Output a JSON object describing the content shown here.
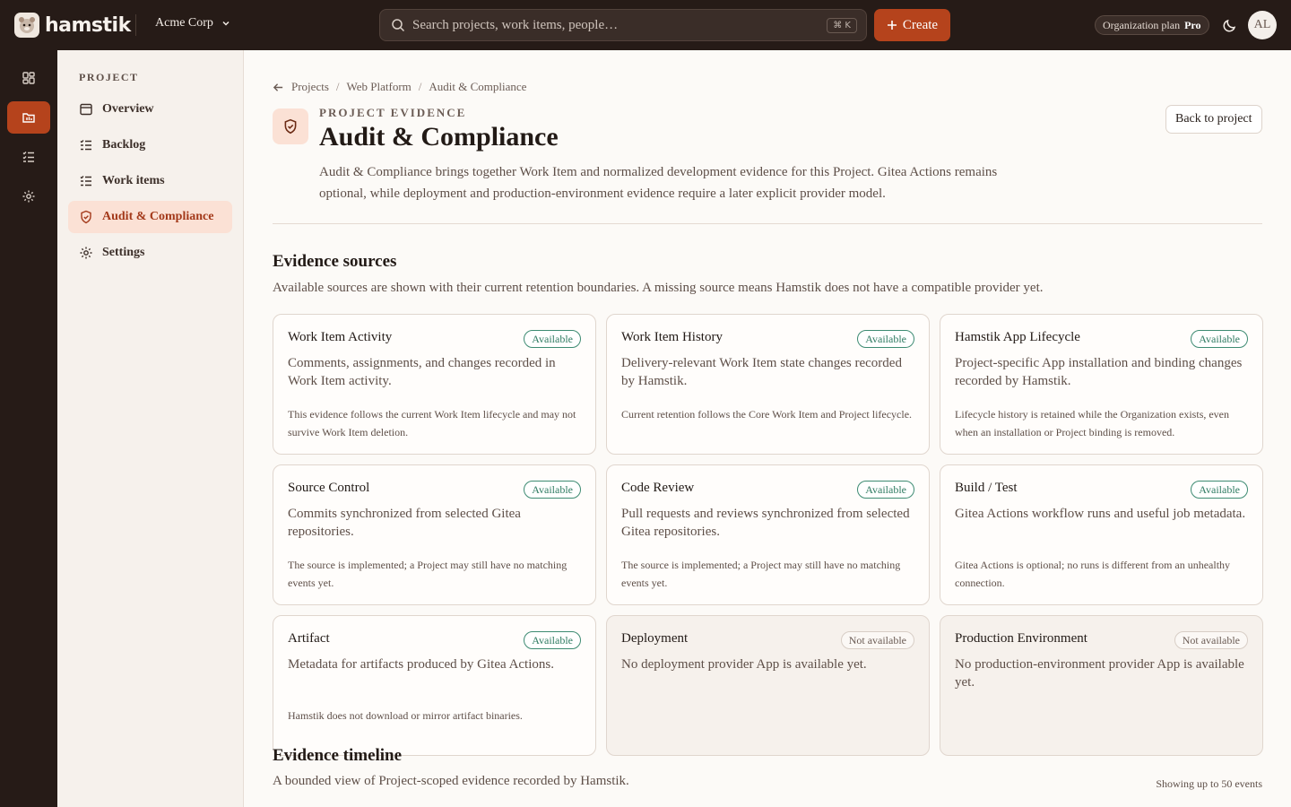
{
  "app": {
    "name": "hamstik"
  },
  "header": {
    "org": "Acme Corp",
    "search_placeholder": "Search projects, work items, people…",
    "search_shortcut": "⌘ K",
    "create_label": "Create",
    "plan_label": "Organization plan",
    "plan_name": "Pro",
    "avatar_initials": "AL"
  },
  "rail": {
    "icons": [
      "dashboard-icon",
      "project-folder-icon",
      "checklist-icon",
      "gear-icon"
    ],
    "active": 1
  },
  "sidebar": {
    "heading": "PROJECT",
    "items": [
      {
        "label": "Overview",
        "icon": "panel-icon"
      },
      {
        "label": "Backlog",
        "icon": "list-icon"
      },
      {
        "label": "Work items",
        "icon": "list-icon"
      },
      {
        "label": "Audit & Compliance",
        "icon": "shield-check-icon",
        "active": true
      },
      {
        "label": "Settings",
        "icon": "gear-icon"
      }
    ]
  },
  "breadcrumb": [
    "Projects",
    "Web Platform",
    "Audit & Compliance"
  ],
  "page": {
    "eyebrow": "PROJECT EVIDENCE",
    "title": "Audit & Compliance",
    "description": "Audit & Compliance brings together Work Item and normalized development evidence for this Project. Gitea Actions remains optional, while deployment and production-environment evidence require a later explicit provider model.",
    "back_label": "Back to project"
  },
  "sources_section": {
    "title": "Evidence sources",
    "description": "Available sources are shown with their current retention boundaries. A missing source means Hamstik does not have a compatible provider yet.",
    "cards": [
      {
        "title": "Work Item Activity",
        "status": "Available",
        "available": true,
        "desc": "Comments, assignments, and changes recorded in Work Item activity.",
        "note": "This evidence follows the current Work Item lifecycle and may not survive Work Item deletion."
      },
      {
        "title": "Work Item History",
        "status": "Available",
        "available": true,
        "desc": "Delivery-relevant Work Item state changes recorded by Hamstik.",
        "note": "Current retention follows the Core Work Item and Project lifecycle."
      },
      {
        "title": "Hamstik App Lifecycle",
        "status": "Available",
        "available": true,
        "desc": "Project-specific App installation and binding changes recorded by Hamstik.",
        "note": "Lifecycle history is retained while the Organization exists, even when an installation or Project binding is removed."
      },
      {
        "title": "Source Control",
        "status": "Available",
        "available": true,
        "desc": "Commits synchronized from selected Gitea repositories.",
        "note": "The source is implemented; a Project may still have no matching events yet."
      },
      {
        "title": "Code Review",
        "status": "Available",
        "available": true,
        "desc": "Pull requests and reviews synchronized from selected Gitea repositories.",
        "note": "The source is implemented; a Project may still have no matching events yet."
      },
      {
        "title": "Build / Test",
        "status": "Available",
        "available": true,
        "desc": "Gitea Actions workflow runs and useful job metadata.",
        "note": "Gitea Actions is optional; no runs is different from an unhealthy connection."
      },
      {
        "title": "Artifact",
        "status": "Available",
        "available": true,
        "desc": "Metadata for artifacts produced by Gitea Actions.",
        "note": "Hamstik does not download or mirror artifact binaries."
      },
      {
        "title": "Deployment",
        "status": "Not available",
        "available": false,
        "desc": "No deployment provider App is available yet.",
        "note": ""
      },
      {
        "title": "Production Environment",
        "status": "Not available",
        "available": false,
        "desc": "No production-environment provider App is available yet.",
        "note": ""
      }
    ]
  },
  "timeline_section": {
    "title": "Evidence timeline",
    "description": "A bounded view of Project-scoped evidence recorded by Hamstik.",
    "count_label": "Showing up to 50 events"
  },
  "colors": {
    "accent": "#b5431c",
    "topbar": "#261b17",
    "available": "#2f7b62"
  }
}
